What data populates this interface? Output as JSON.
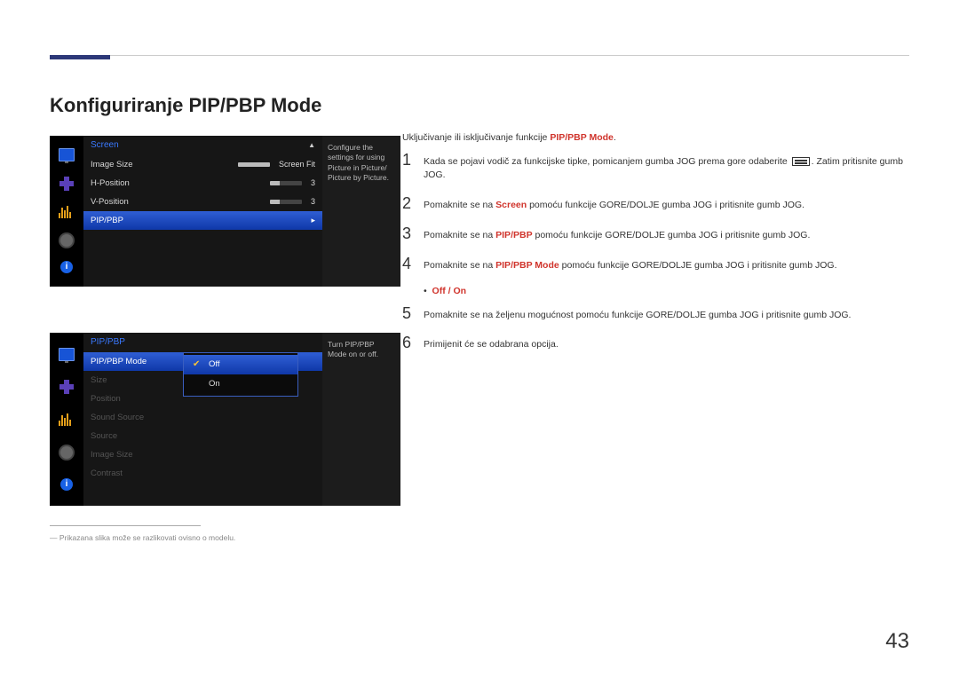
{
  "header_accent": "#2c3878",
  "title": "Konfiguriranje PIP/PBP Mode",
  "intro_prefix": "Uključivanje ili isključivanje funkcije ",
  "intro_highlight": "PIP/PBP Mode",
  "intro_suffix": ".",
  "steps": [
    {
      "num": "1",
      "pre": "Kada se pojavi vodič za funkcijske tipke, pomicanjem gumba JOG prema gore odaberite ",
      "icon": true,
      "post": ". Zatim pritisnite gumb JOG."
    },
    {
      "num": "2",
      "pre": "Pomaknite se na ",
      "hl": "Screen",
      "post": " pomoću funkcije GORE/DOLJE gumba JOG i pritisnite gumb JOG."
    },
    {
      "num": "3",
      "pre": "Pomaknite se na ",
      "hl": "PIP/PBP",
      "post": " pomoću funkcije GORE/DOLJE gumba JOG i pritisnite gumb JOG."
    },
    {
      "num": "4",
      "pre": "Pomaknite se na ",
      "hl": "PIP/PBP Mode",
      "post": " pomoću funkcije GORE/DOLJE gumba JOG i pritisnite gumb JOG."
    },
    {
      "num": "5",
      "pre": "Pomaknite se na željenu mogućnost pomoću funkcije GORE/DOLJE gumba JOG i pritisnite gumb JOG."
    },
    {
      "num": "6",
      "pre": "Primijenit će se odabrana opcija."
    }
  ],
  "options_bullet": "•",
  "options_text": "Off / On",
  "osd1": {
    "title": "Screen",
    "rows": [
      {
        "label": "Image Size",
        "value": "Screen Fit"
      },
      {
        "label": "H-Position",
        "value": "3"
      },
      {
        "label": "V-Position",
        "value": "3"
      },
      {
        "label": "PIP/PBP",
        "selected": true,
        "arrow": "▸"
      }
    ],
    "desc": "Configure the settings for using Picture in Picture/ Picture by Picture."
  },
  "osd2": {
    "title": "PIP/PBP",
    "rows": [
      {
        "label": "PIP/PBP Mode",
        "selected": true
      },
      {
        "label": "Size",
        "dim": true
      },
      {
        "label": "Position",
        "dim": true
      },
      {
        "label": "Sound Source",
        "dim": true
      },
      {
        "label": "Source",
        "dim": true
      },
      {
        "label": "Image Size",
        "dim": true
      },
      {
        "label": "Contrast",
        "dim": true
      }
    ],
    "popup_options": [
      "Off",
      "On"
    ],
    "popup_selected": "Off",
    "desc": "Turn PIP/PBP Mode on or off."
  },
  "footnote_mark": "―",
  "footnote": "Prikazana slika može se razlikovati ovisno o modelu.",
  "page_number": "43"
}
